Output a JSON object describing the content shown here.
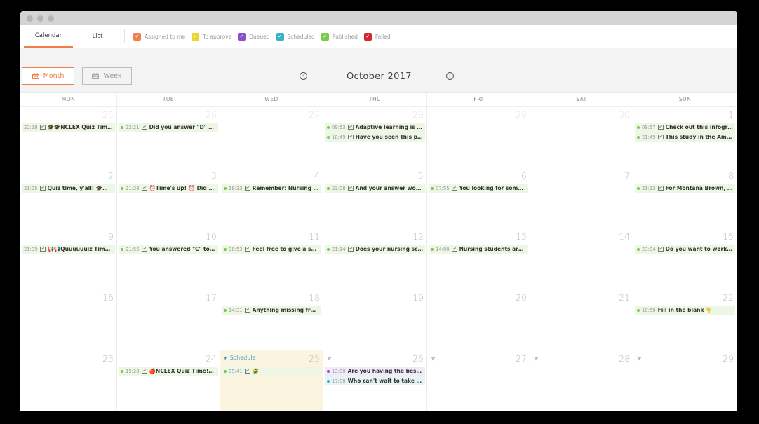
{
  "tabs": [
    {
      "label": "Calendar",
      "active": true
    },
    {
      "label": "List",
      "active": false
    }
  ],
  "legend": [
    {
      "label": "Assigned to me",
      "color": "#f07d4a",
      "checked": true
    },
    {
      "label": "To approve",
      "color": "#e8d62a",
      "checked": true
    },
    {
      "label": "Queued",
      "color": "#8a4fc9",
      "checked": true
    },
    {
      "label": "Scheduled",
      "color": "#35b4c8",
      "checked": true
    },
    {
      "label": "Published",
      "color": "#7ac94f",
      "checked": true
    },
    {
      "label": "Failed",
      "color": "#d7262b",
      "checked": true
    }
  ],
  "view_buttons": {
    "month": "Month",
    "week": "Week",
    "active": "month"
  },
  "nav": {
    "title": "October 2017",
    "prev_icon": "chevron-left-circle",
    "next_icon": "chevron-right-circle"
  },
  "weekdays": [
    "MON",
    "TUE",
    "WED",
    "THU",
    "FRI",
    "SAT",
    "SUN"
  ],
  "schedule_label": "Schedule",
  "colors": {
    "accent": "#f07d4a",
    "published": "#7ac94f",
    "queued": "#8a4fc9",
    "scheduled": "#35b4c8",
    "today_bg": "#fbf5df"
  },
  "weeks": [
    [
      {
        "day": "25",
        "other": true,
        "posts": [
          {
            "time": "22:18",
            "text": "🎓🎓NCLEX Quiz Time! ...",
            "status": "published",
            "image": true,
            "dot": false
          }
        ]
      },
      {
        "day": "26",
        "other": true,
        "posts": [
          {
            "time": "22:21",
            "text": "Did you answer \"D\" to t...",
            "status": "published",
            "image": true,
            "dot": true
          }
        ]
      },
      {
        "day": "27",
        "other": true,
        "posts": []
      },
      {
        "day": "28",
        "other": true,
        "posts": [
          {
            "time": "09:53",
            "text": "Adaptive learning is a p...",
            "status": "published",
            "image": true,
            "dot": true
          },
          {
            "time": "10:49",
            "text": "Have you seen this phot...",
            "status": "published",
            "image": true,
            "dot": true
          }
        ]
      },
      {
        "day": "29",
        "other": true,
        "posts": []
      },
      {
        "day": "30",
        "other": true,
        "posts": []
      },
      {
        "day": "1",
        "other": false,
        "posts": [
          {
            "time": "09:57",
            "text": "Check out this infograp...",
            "status": "published",
            "image": true,
            "dot": true
          },
          {
            "time": "21:49",
            "text": "This study in the Americ...",
            "status": "published",
            "image": true,
            "dot": true
          }
        ]
      }
    ],
    [
      {
        "day": "2",
        "other": false,
        "posts": [
          {
            "time": "21:25",
            "text": "Quiz time, y'all! 🎓Whic...",
            "status": "published",
            "image": true,
            "dot": false
          }
        ]
      },
      {
        "day": "3",
        "other": false,
        "posts": [
          {
            "time": "21:28",
            "text": "⏰Time's up! ⏰ Did yo...",
            "status": "published",
            "image": true,
            "dot": true
          }
        ]
      },
      {
        "day": "4",
        "other": false,
        "posts": [
          {
            "time": "18:33",
            "text": "Remember: Nursing sch...",
            "status": "published",
            "image": true,
            "dot": true
          }
        ]
      },
      {
        "day": "5",
        "other": false,
        "posts": [
          {
            "time": "23:08",
            "text": "And your answer would...",
            "status": "published",
            "image": true,
            "dot": true
          }
        ]
      },
      {
        "day": "6",
        "other": false,
        "posts": [
          {
            "time": "07:55",
            "text": "You looking for some n...",
            "status": "published",
            "image": true,
            "dot": true
          }
        ]
      },
      {
        "day": "7",
        "other": false,
        "posts": []
      },
      {
        "day": "8",
        "other": false,
        "posts": [
          {
            "time": "21:13",
            "text": "For Montana Brown, sh...",
            "status": "published",
            "image": true,
            "dot": true
          }
        ]
      }
    ],
    [
      {
        "day": "9",
        "other": false,
        "posts": [
          {
            "time": "21:39",
            "text": "📢📢Quuuuuuiz Time! ...",
            "status": "published",
            "image": true,
            "dot": false
          }
        ]
      },
      {
        "day": "10",
        "other": false,
        "posts": [
          {
            "time": "21:56",
            "text": "You answered \"C\" to thi...",
            "status": "published",
            "image": true,
            "dot": true
          }
        ]
      },
      {
        "day": "11",
        "other": false,
        "posts": [
          {
            "time": "08:53",
            "text": "Feel free to give a shout...",
            "status": "published",
            "image": true,
            "dot": true
          }
        ]
      },
      {
        "day": "12",
        "other": false,
        "posts": [
          {
            "time": "21:14",
            "text": "Does your nursing scho...",
            "status": "published",
            "image": true,
            "dot": true
          }
        ]
      },
      {
        "day": "13",
        "other": false,
        "posts": [
          {
            "time": "14:00",
            "text": "Nursing students are th...",
            "status": "published",
            "image": true,
            "dot": true
          }
        ]
      },
      {
        "day": "14",
        "other": false,
        "posts": []
      },
      {
        "day": "15",
        "other": false,
        "posts": [
          {
            "time": "23:04",
            "text": "Do you want to work at ...",
            "status": "published",
            "image": true,
            "dot": true
          }
        ]
      }
    ],
    [
      {
        "day": "16",
        "other": false,
        "posts": []
      },
      {
        "day": "17",
        "other": false,
        "posts": []
      },
      {
        "day": "18",
        "other": false,
        "posts": [
          {
            "time": "14:31",
            "text": "Anything missing from t...",
            "status": "published",
            "image": true,
            "dot": true
          }
        ]
      },
      {
        "day": "19",
        "other": false,
        "posts": []
      },
      {
        "day": "20",
        "other": false,
        "posts": []
      },
      {
        "day": "21",
        "other": false,
        "posts": []
      },
      {
        "day": "22",
        "other": false,
        "posts": [
          {
            "time": "18:58",
            "text": "Fill in the blank 👇",
            "status": "published",
            "image": false,
            "dot": true
          }
        ]
      }
    ],
    [
      {
        "day": "23",
        "other": false,
        "posts": []
      },
      {
        "day": "24",
        "other": false,
        "posts": [
          {
            "time": "15:28",
            "text": "🍎NCLEX Quiz Time!🍎 ...",
            "status": "published",
            "image": true,
            "dot": true
          }
        ]
      },
      {
        "day": "25",
        "other": false,
        "today": true,
        "schedule": true,
        "posts": [
          {
            "time": "09:41",
            "text": "🤣",
            "status": "published",
            "image": true,
            "dot": true
          }
        ]
      },
      {
        "day": "26",
        "other": false,
        "send": true,
        "posts": [
          {
            "time": "13:00",
            "text": "Are you having the best ye...",
            "status": "queued",
            "image": false,
            "dot": true
          },
          {
            "time": "17:00",
            "text": "Who can't wait to take the...",
            "status": "scheduled",
            "image": false,
            "dot": true
          }
        ]
      },
      {
        "day": "27",
        "other": false,
        "send": true,
        "posts": []
      },
      {
        "day": "28",
        "other": false,
        "send": true,
        "posts": []
      },
      {
        "day": "29",
        "other": false,
        "send": true,
        "posts": []
      }
    ]
  ]
}
